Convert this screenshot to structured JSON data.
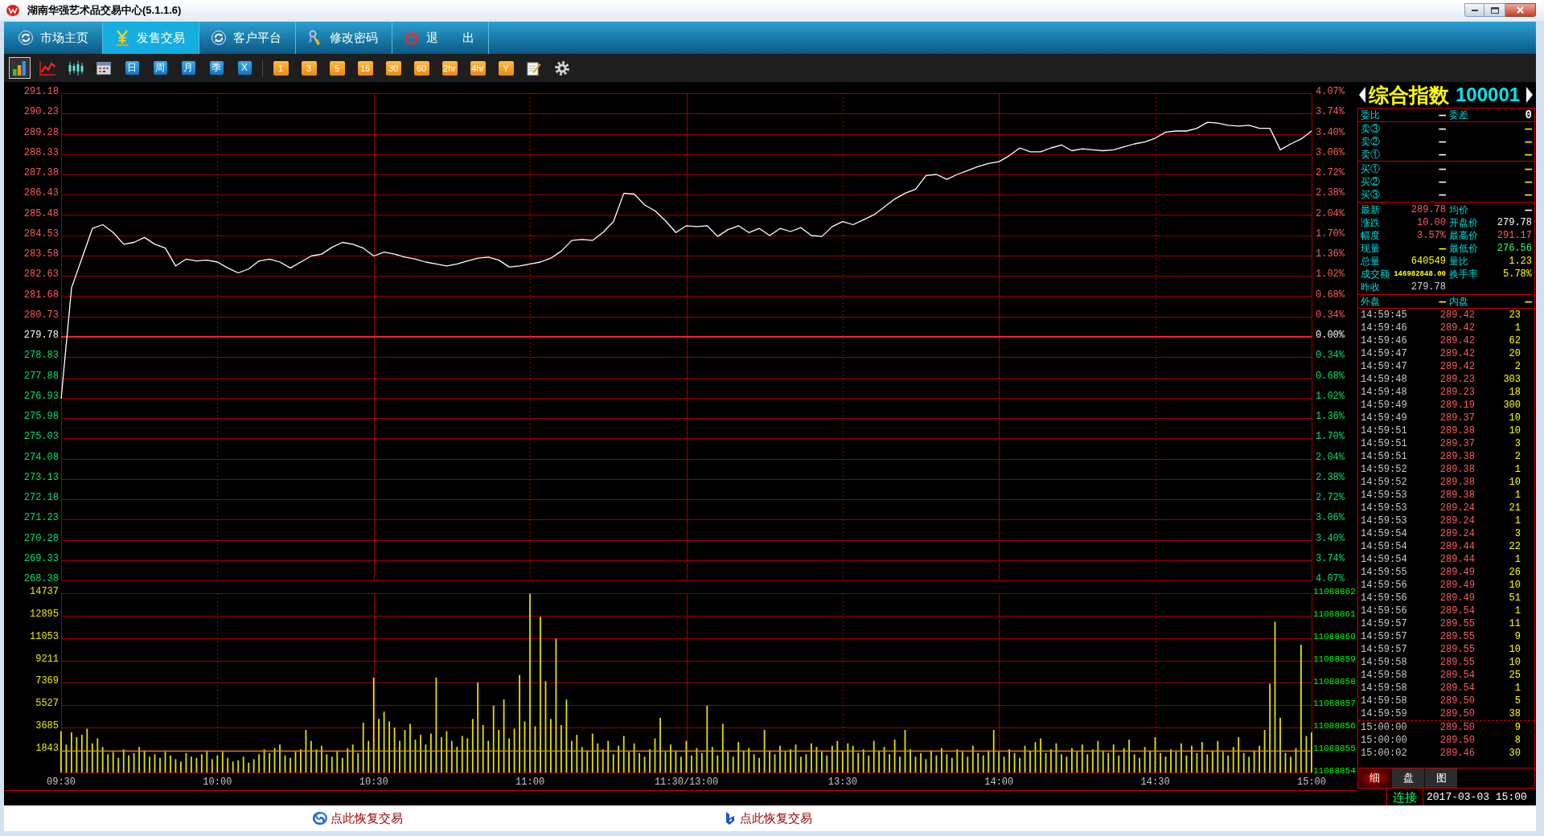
{
  "window": {
    "title": "湖南华强艺术品交易中心(5.1.1.6)"
  },
  "nav_tabs": [
    {
      "label": "市场主页",
      "selected": false
    },
    {
      "label": "发售交易",
      "selected": true
    },
    {
      "label": "客户平台",
      "selected": false
    },
    {
      "label": "修改密码",
      "selected": false
    },
    {
      "label": "退　　出",
      "selected": false
    }
  ],
  "toolbar": {
    "chart_type_buttons": [
      {
        "selected": true
      },
      {
        "selected": false
      },
      {
        "selected": false
      },
      {
        "selected": false
      }
    ],
    "period_buttons": [
      {
        "label": "日",
        "kind": "calendar"
      },
      {
        "label": "周",
        "kind": "calendar"
      },
      {
        "label": "月",
        "kind": "calendar"
      },
      {
        "label": "季",
        "kind": "calendar"
      },
      {
        "label": "X",
        "kind": "calendar"
      },
      {
        "label": "1",
        "kind": "minute"
      },
      {
        "label": "3",
        "kind": "minute"
      },
      {
        "label": "5",
        "kind": "minute"
      },
      {
        "label": "15",
        "kind": "minute"
      },
      {
        "label": "30",
        "kind": "minute"
      },
      {
        "label": "60",
        "kind": "minute"
      },
      {
        "label": "2hr",
        "kind": "minute"
      },
      {
        "label": "4hr",
        "kind": "minute"
      },
      {
        "label": "Y",
        "kind": "minute"
      }
    ]
  },
  "chart": {
    "price_chart": {
      "chart_data": {
        "type": "line",
        "ylim": [
          268.38,
          291.18
        ],
        "yticks": [
          291.18,
          290.23,
          289.28,
          288.33,
          287.38,
          286.43,
          285.48,
          284.53,
          283.58,
          282.63,
          281.68,
          280.73,
          279.78,
          278.83,
          277.88,
          276.93,
          275.98,
          275.03,
          274.08,
          273.13,
          272.18,
          271.23,
          270.28,
          269.33,
          268.38
        ],
        "grid": true,
        "series": [
          {
            "color": "#ffffff",
            "values": [
              276.88,
              282.08,
              283.46,
              284.85,
              285.03,
              284.66,
              284.11,
              284.2,
              284.43,
              284.11,
              283.93,
              283.1,
              283.42,
              283.33,
              283.37,
              283.28,
              283.0,
              282.77,
              282.96,
              283.33,
              283.42,
              283.28,
              283.0,
              283.28,
              283.56,
              283.65,
              283.97,
              284.2,
              284.11,
              283.93,
              283.56,
              283.74,
              283.65,
              283.51,
              283.42,
              283.28,
              283.19,
              283.1,
              283.19,
              283.33,
              283.46,
              283.51,
              283.37,
              283.05,
              283.1,
              283.19,
              283.28,
              283.46,
              283.79,
              284.29,
              284.34,
              284.29,
              284.66,
              285.17,
              286.5,
              286.46,
              285.95,
              285.68,
              285.21,
              284.66,
              284.98,
              284.94,
              284.98,
              284.48,
              284.8,
              284.98,
              284.66,
              284.85,
              284.52,
              284.85,
              284.71,
              284.89,
              284.52,
              284.48,
              284.94,
              285.17,
              285.03,
              285.26,
              285.49,
              285.86,
              286.23,
              286.5,
              286.69,
              287.33,
              287.38,
              287.15,
              287.38,
              287.56,
              287.75,
              287.89,
              287.98,
              288.26,
              288.62,
              288.44,
              288.44,
              288.62,
              288.76,
              288.49,
              288.58,
              288.53,
              288.49,
              288.53,
              288.67,
              288.81,
              288.9,
              289.08,
              289.36,
              289.41,
              289.41,
              289.54,
              289.82,
              289.78,
              289.68,
              289.64,
              289.68,
              289.54,
              289.54,
              288.53,
              288.81,
              289.04,
              289.41
            ]
          }
        ],
        "ref_lines": [
          {
            "axis": "y",
            "value": 279.78,
            "color": "#ff2020"
          }
        ]
      },
      "percent_labels": [
        "4.07%",
        "3.74%",
        "3.40%",
        "3.06%",
        "2.72%",
        "2.38%",
        "2.04%",
        "1.70%",
        "1.36%",
        "1.02%",
        "0.68%",
        "0.34%",
        "0.00%",
        "0.34%",
        "0.68%",
        "1.02%",
        "1.36%",
        "1.70%",
        "2.04%",
        "2.38%",
        "2.72%",
        "3.06%",
        "3.40%",
        "3.74%",
        "4.07%"
      ]
    },
    "volume_chart": {
      "chart_data": {
        "type": "bar",
        "ylim": [
          0,
          14737
        ],
        "yticks": [
          14737,
          12895,
          11053,
          9211,
          7369,
          5527,
          3685,
          1843
        ],
        "grid": true,
        "series": [
          {
            "color": "#e0e000",
            "values": [
              3400,
              2300,
              3300,
              2900,
              3100,
              3600,
              2400,
              2800,
              2100,
              1500,
              1700,
              1200,
              1900,
              1400,
              1600,
              2100,
              1800,
              1300,
              1500,
              1200,
              1700,
              1400,
              1100,
              900,
              1600,
              1300,
              1200,
              1500,
              1800,
              1100,
              1400,
              1700,
              1200,
              900,
              1000,
              1300,
              800,
              1100,
              1500,
              1900,
              1600,
              2000,
              2300,
              1400,
              1200,
              1700,
              1900,
              3500,
              2600,
              1900,
              2200,
              1500,
              1300,
              1800,
              1200,
              2000,
              2300,
              1600,
              4100,
              2600,
              7800,
              4400,
              5000,
              4200,
              3700,
              2600,
              3500,
              4000,
              2700,
              3100,
              2300,
              3200,
              7800,
              2900,
              3400,
              2600,
              2100,
              3000,
              2800,
              4400,
              7400,
              3900,
              2600,
              5500,
              3500,
              6000,
              2800,
              3600,
              8000,
              4200,
              14700,
              3800,
              12800,
              7500,
              4400,
              11000,
              3900,
              6000,
              2600,
              3100,
              2100,
              1800,
              3200,
              2400,
              1900,
              2600,
              1500,
              2200,
              3000,
              1700,
              2400,
              1600,
              1300,
              1900,
              2800,
              4500,
              1700,
              2300,
              1800,
              1300,
              2600,
              1400,
              2000,
              1600,
              5500,
              2100,
              1400,
              4000,
              1700,
              1300,
              2500,
              1800,
              2000,
              1500,
              1200,
              3500,
              1800,
              1500,
              2200,
              1700,
              1900,
              2300,
              1300,
              1500,
              2400,
              2100,
              1700,
              1400,
              2200,
              2600,
              1800,
              2400,
              2200,
              1600,
              1900,
              1400,
              2600,
              1800,
              2100,
              1500,
              2700,
              1300,
              3500,
              1900,
              1300,
              1600,
              1100,
              1800,
              1400,
              2000,
              1500,
              1200,
              1900,
              1700,
              1300,
              2200,
              1600,
              1400,
              1800,
              3500,
              1700,
              1300,
              1900,
              1600,
              1200,
              2200,
              1800,
              2500,
              2800,
              1600,
              1900,
              2400,
              1500,
              1300,
              2000,
              1700,
              2300,
              1500,
              1900,
              2600,
              1800,
              1600,
              2300,
              1400,
              2000,
              2700,
              1500,
              1200,
              2100,
              1800,
              2900,
              1600,
              1300,
              1900,
              1700,
              2400,
              1400,
              2200,
              1600,
              2500,
              1500,
              1800,
              2600,
              1700,
              1400,
              2100,
              2900,
              1600,
              1300,
              1800,
              2200,
              3500,
              7300,
              12400,
              4500,
              1600,
              1300,
              2000,
              10500,
              3000,
              3300
            ]
          }
        ],
        "ref_lines": [
          {
            "axis": "y",
            "value": 1800,
            "color": "#00ff00"
          }
        ]
      },
      "amount_labels": [
        "11088862",
        "11088861",
        "11088860",
        "11088859",
        "11088858",
        "11088857",
        "11088856",
        "11088855",
        "11088854"
      ],
      "time_labels": [
        "09:30",
        "10:00",
        "10:30",
        "11:00",
        "11:30/13:00",
        "13:30",
        "14:00",
        "14:30",
        "15:00"
      ]
    }
  },
  "quote_panel": {
    "name": "综合指数",
    "code": "100001",
    "sections": [
      [
        {
          "label": "委比",
          "value": {
            "text": "—",
            "color": "#ffffff"
          },
          "label_2": "委差",
          "value_2": {
            "text": "0",
            "color": "#ffffff"
          }
        }
      ],
      [
        {
          "label": "卖③",
          "value": {
            "text": "—",
            "color": "#ffffff"
          },
          "value_2": {
            "text": "—",
            "color": "#ffff00"
          }
        },
        {
          "label": "卖②",
          "value": {
            "text": "—",
            "color": "#ffffff"
          },
          "value_2": {
            "text": "—",
            "color": "#ffff00"
          }
        },
        {
          "label": "卖①",
          "value": {
            "text": "—",
            "color": "#ffffff"
          },
          "value_2": {
            "text": "—",
            "color": "#ffff00"
          }
        }
      ],
      [
        {
          "label": "买①",
          "value": {
            "text": "—",
            "color": "#ffffff"
          },
          "value_2": {
            "text": "—",
            "color": "#ffff00"
          }
        },
        {
          "label": "买②",
          "value": {
            "text": "—",
            "color": "#ffffff"
          },
          "value_2": {
            "text": "—",
            "color": "#ffff00"
          }
        },
        {
          "label": "买③",
          "value": {
            "text": "—",
            "color": "#ffffff"
          },
          "value_2": {
            "text": "—",
            "color": "#ffff00"
          }
        }
      ],
      [
        {
          "label": "最新",
          "value": {
            "text": "289.78",
            "color": "#ff5c5c"
          },
          "label_2": "均价",
          "value_2": {
            "text": "—",
            "color": "#ffffff"
          }
        },
        {
          "label": "涨跌",
          "value": {
            "text": "10.00",
            "color": "#ff5c5c"
          },
          "label_2": "开盘价",
          "value_2": {
            "text": "279.78",
            "color": "#ffffff"
          }
        },
        {
          "label": "幅度",
          "value": {
            "text": "3.57%",
            "color": "#ff5c5c"
          },
          "label_2": "最高价",
          "value_2": {
            "text": "291.17",
            "color": "#ff5c5c"
          }
        },
        {
          "label": "现量",
          "value": {
            "text": "—",
            "color": "#ffff00"
          },
          "label_2": "最低价",
          "value_2": {
            "text": "276.56",
            "color": "#33ff66"
          }
        },
        {
          "label": "总量",
          "value": {
            "text": "640549",
            "color": "#ffff00"
          },
          "label_2": "量比",
          "value_2": {
            "text": "1.23",
            "color": "#ffff00"
          }
        },
        {
          "label": "成交额",
          "value": {
            "text": "146982848.00",
            "color": "#ffff00"
          },
          "label_2": "换手率",
          "value_2": {
            "text": "5.78%",
            "color": "#ffff00"
          }
        },
        {
          "label": "昨收",
          "value": {
            "text": "279.78",
            "color": "#d0d0d0"
          }
        }
      ],
      [
        {
          "label": "外盘",
          "value": {
            "text": "—",
            "color": "#ffff00"
          },
          "label_2": "内盘",
          "value_2": {
            "text": "—",
            "color": "#ffff00"
          }
        }
      ]
    ],
    "trades": [
      {
        "time": "14:59:45",
        "price": "289.42",
        "volume": "23"
      },
      {
        "time": "14:59:46",
        "price": "289.42",
        "volume": "1"
      },
      {
        "time": "14:59:46",
        "price": "289.42",
        "volume": "62"
      },
      {
        "time": "14:59:47",
        "price": "289.42",
        "volume": "20"
      },
      {
        "time": "14:59:47",
        "price": "289.42",
        "volume": "2"
      },
      {
        "time": "14:59:48",
        "price": "289.23",
        "volume": "303"
      },
      {
        "time": "14:59:48",
        "price": "289.23",
        "volume": "18"
      },
      {
        "time": "14:59:49",
        "price": "289.19",
        "volume": "300"
      },
      {
        "time": "14:59:49",
        "price": "289.37",
        "volume": "10"
      },
      {
        "time": "14:59:51",
        "price": "289.38",
        "volume": "10"
      },
      {
        "time": "14:59:51",
        "price": "289.37",
        "volume": "3"
      },
      {
        "time": "14:59:51",
        "price": "289.38",
        "volume": "2"
      },
      {
        "time": "14:59:52",
        "price": "289.38",
        "volume": "1"
      },
      {
        "time": "14:59:52",
        "price": "289.38",
        "volume": "10"
      },
      {
        "time": "14:59:53",
        "price": "289.38",
        "volume": "1"
      },
      {
        "time": "14:59:53",
        "price": "289.24",
        "volume": "21"
      },
      {
        "time": "14:59:53",
        "price": "289.24",
        "volume": "1"
      },
      {
        "time": "14:59:54",
        "price": "289.24",
        "volume": "3"
      },
      {
        "time": "14:59:54",
        "price": "289.44",
        "volume": "22"
      },
      {
        "time": "14:59:54",
        "price": "289.44",
        "volume": "1"
      },
      {
        "time": "14:59:55",
        "price": "289.49",
        "volume": "26"
      },
      {
        "time": "14:59:56",
        "price": "289.49",
        "volume": "10"
      },
      {
        "time": "14:59:56",
        "price": "289.49",
        "volume": "51"
      },
      {
        "time": "14:59:56",
        "price": "289.54",
        "volume": "1"
      },
      {
        "time": "14:59:57",
        "price": "289.55",
        "volume": "11"
      },
      {
        "time": "14:59:57",
        "price": "289.55",
        "volume": "9"
      },
      {
        "time": "14:59:57",
        "price": "289.55",
        "volume": "10"
      },
      {
        "time": "14:59:58",
        "price": "289.55",
        "volume": "10"
      },
      {
        "time": "14:59:58",
        "price": "289.54",
        "volume": "25"
      },
      {
        "time": "14:59:58",
        "price": "289.54",
        "volume": "1"
      },
      {
        "time": "14:59:58",
        "price": "289.50",
        "volume": "5"
      },
      {
        "time": "14:59:59",
        "price": "289.50",
        "volume": "38"
      }
    ],
    "closing_trades": [
      {
        "time": "15:00:00",
        "price": "289.50",
        "volume": "9"
      },
      {
        "time": "15:00:00",
        "price": "289.50",
        "volume": "8"
      },
      {
        "time": "15:00:02",
        "price": "289.46",
        "volume": "30"
      }
    ],
    "detail_tabs": [
      {
        "label": "细",
        "selected": true
      },
      {
        "label": "盘",
        "selected": false
      },
      {
        "label": "图",
        "selected": false
      }
    ]
  },
  "status": {
    "connection": "连接",
    "datetime": "2017-03-03 15:00"
  },
  "footer_links": [
    {
      "label": "点此恢复交易"
    },
    {
      "label": "点此恢复交易"
    }
  ]
}
